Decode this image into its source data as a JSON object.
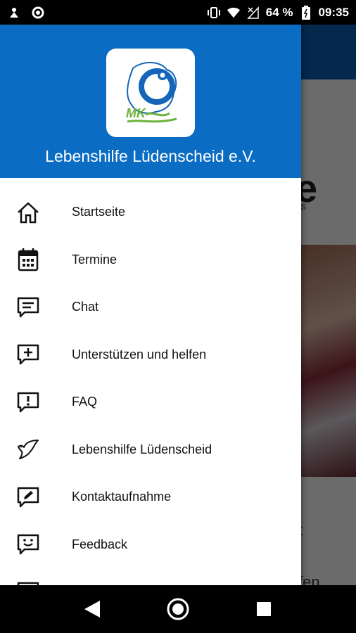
{
  "status_bar": {
    "battery_percent": "64 %",
    "time": "09:35",
    "icons": [
      "notification-icon",
      "sync-icon",
      "vibrate-icon",
      "wifi-icon",
      "signal-icon",
      "battery-icon"
    ]
  },
  "drawer": {
    "org_name": "Lebenshilfe Lüdenscheid e.V.",
    "logo_text": "MK",
    "items": [
      {
        "label": "Startseite",
        "icon": "home-icon"
      },
      {
        "label": "Termine",
        "icon": "calendar-icon"
      },
      {
        "label": "Chat",
        "icon": "chat-icon"
      },
      {
        "label": "Unterstützen und helfen",
        "icon": "support-icon"
      },
      {
        "label": "FAQ",
        "icon": "faq-icon"
      },
      {
        "label": "Lebenshilfe Lüdenscheid",
        "icon": "dove-icon"
      },
      {
        "label": "Kontaktaufnahme",
        "icon": "contact-icon"
      },
      {
        "label": "Feedback",
        "icon": "feedback-icon"
      }
    ]
  },
  "background": {
    "title_fragment": "e",
    "subtitle_fragment": "is",
    "text1_fragment": "t",
    "text2_fragment": "fen"
  },
  "colors": {
    "header_blue": "#0a6cc3",
    "logo_green": "#6cb33e",
    "logo_blue": "#1565b8"
  }
}
